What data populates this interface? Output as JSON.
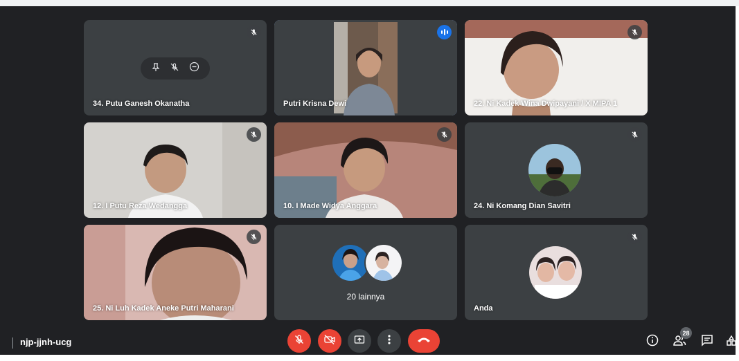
{
  "meeting": {
    "code": "njp-jjnh-ucg",
    "participant_count": "28"
  },
  "tiles": [
    {
      "name": "34. Putu Ganesh Okanatha"
    },
    {
      "name": "Putri Krisna Dewi"
    },
    {
      "name": "22. Ni Kadek Wina Dwipayani / X MIPA 1"
    },
    {
      "name": "12. I Putu Reza Wedangga"
    },
    {
      "name": "10. I Made Widya Anggara"
    },
    {
      "name": "24. Ni Komang Dian Savitri"
    },
    {
      "name": "25. Ni Luh Kadek Aneke Putri Maharani"
    },
    {
      "name": "20 lainnya"
    },
    {
      "name": "Anda"
    }
  ],
  "icons": {
    "mic_off": "mic-off-icon",
    "pin": "pin-icon",
    "remove": "remove-icon",
    "camera_off": "camera-off-icon",
    "present": "present-icon",
    "more": "more-vert-icon",
    "end_call": "end-call-icon",
    "info": "info-icon",
    "people": "people-icon",
    "chat": "chat-icon",
    "activities": "activities-icon"
  },
  "colors": {
    "background": "#202124",
    "tile": "#3c4043",
    "accent": "#8ab4f8",
    "danger": "#ea4335",
    "speaking": "#1a73e8"
  }
}
